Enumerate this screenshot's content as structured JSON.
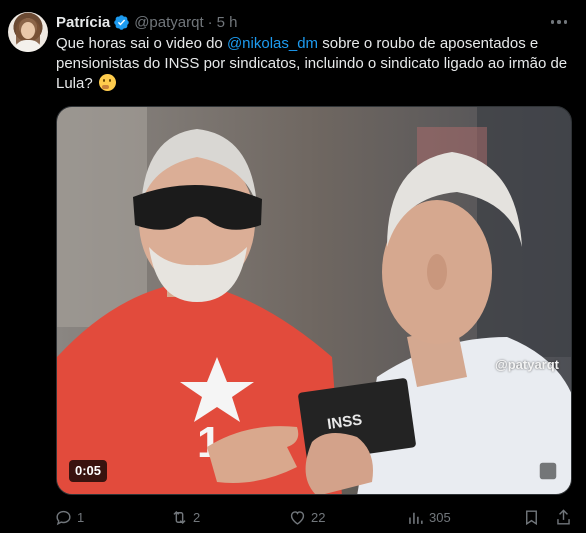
{
  "author": {
    "name": "Patrícia",
    "handle": "@patyarqt",
    "separator": "·",
    "time": "5 h"
  },
  "tweet": {
    "text_before": "Que horas sai o video do ",
    "mention": "@nikolas_dm",
    "text_after": " sobre o roubo de aposentados e pensionistas do INSS por sindicatos, incluindo o sindicato ligado ao irmão de Lula? "
  },
  "media": {
    "watermark": "@patyarqt",
    "card_label": "INSS",
    "duration": "0:05"
  },
  "actions": {
    "replies": "1",
    "reposts": "2",
    "likes": "22",
    "views": "305"
  },
  "colors": {
    "accent": "#1d9bf0",
    "muted": "#71767b",
    "text": "#e7e9ea",
    "background": "#000000"
  }
}
